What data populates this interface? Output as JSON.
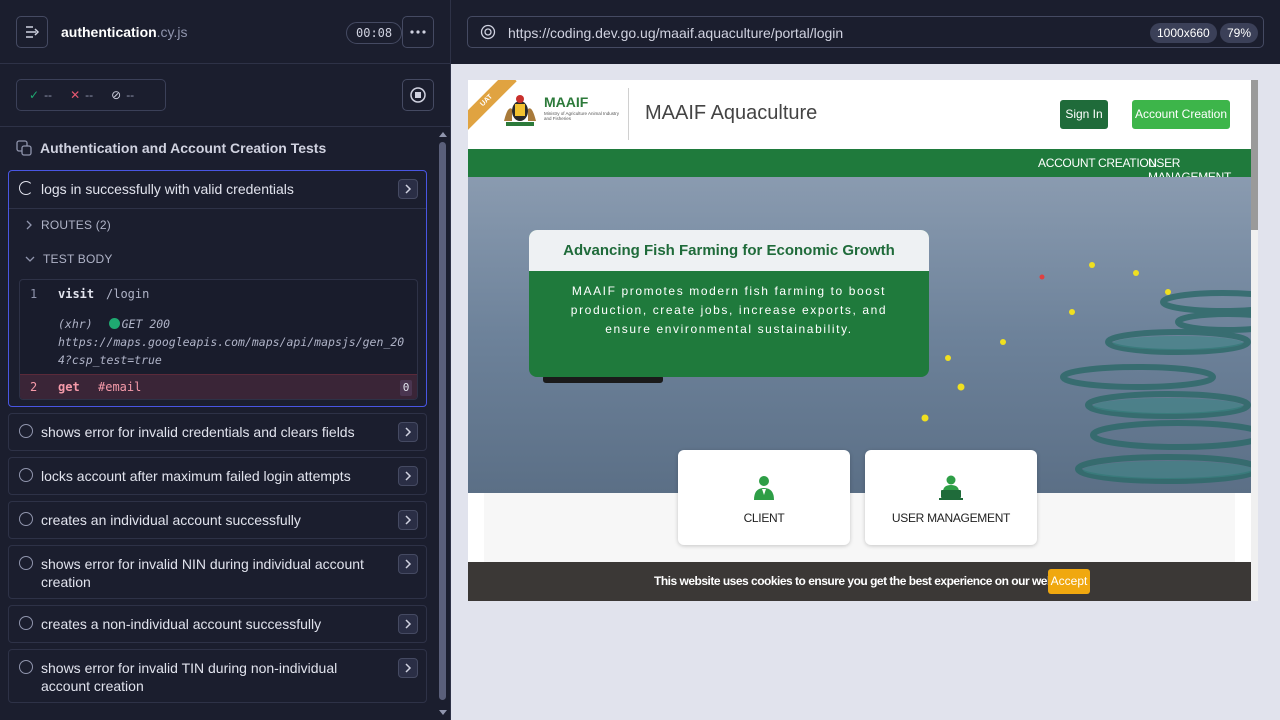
{
  "runner": {
    "spec_file": "authentication",
    "spec_ext": ".cy.js",
    "timer": "00:08",
    "stats": {
      "passed": "--",
      "failed": "--",
      "pending": "--"
    },
    "suite_title": "Authentication and Account Creation Tests",
    "tests": [
      {
        "title": "logs in successfully with valid credentials"
      },
      {
        "title": "shows error for invalid credentials and clears fields"
      },
      {
        "title": "locks account after maximum failed login attempts"
      },
      {
        "title": "creates an individual account successfully"
      },
      {
        "title": "shows error for invalid NIN during individual account creation"
      },
      {
        "title": "creates a non-individual account successfully"
      },
      {
        "title": "shows error for invalid TIN during non-individual account creation"
      }
    ],
    "routes_label": "ROUTES (2)",
    "test_body_label": "TEST BODY",
    "commands": [
      {
        "num": "1",
        "name": "visit",
        "arg": "/login"
      },
      {
        "num": "2",
        "name": "get",
        "arg": "#email",
        "badge": "0"
      }
    ],
    "xhr": {
      "tag": "(xhr)",
      "method": "GET 200",
      "url": "https://maps.googleapis.com/maps/api/mapsjs/gen_204?csp_test=true"
    }
  },
  "aut": {
    "url": "https://coding.dev.go.ug/maaif.aquaculture/portal/login",
    "viewport": "1000x660",
    "zoom": "79%"
  },
  "site": {
    "ribbon": "UAT",
    "brand_name": "MAAIF",
    "brand_sub": "Ministry of Agriculture Animal Industry and Fisheries",
    "title": "MAAIF Aquaculture",
    "sign_in": "Sign In",
    "account_creation": "Account Creation",
    "nav": [
      "ACCOUNT CREATION",
      "USER MANAGEMENT"
    ],
    "hero_heading": "Advancing Fish Farming for Economic Growth",
    "hero_body": "MAAIF promotes modern fish farming to boost production, create jobs, increase exports, and ensure environmental sustainability.",
    "tiles": [
      "CLIENT",
      "USER MANAGEMENT"
    ],
    "cookie_text": "This website uses cookies to ensure you get the best experience on our website.",
    "cookie_accept": "Accept"
  },
  "colors": {
    "runner_bg": "#1b1e2e",
    "active_border": "#4956e3",
    "site_green": "#1f7a3c",
    "btn_green": "#3db54a",
    "accept_orange": "#f0a80f"
  }
}
